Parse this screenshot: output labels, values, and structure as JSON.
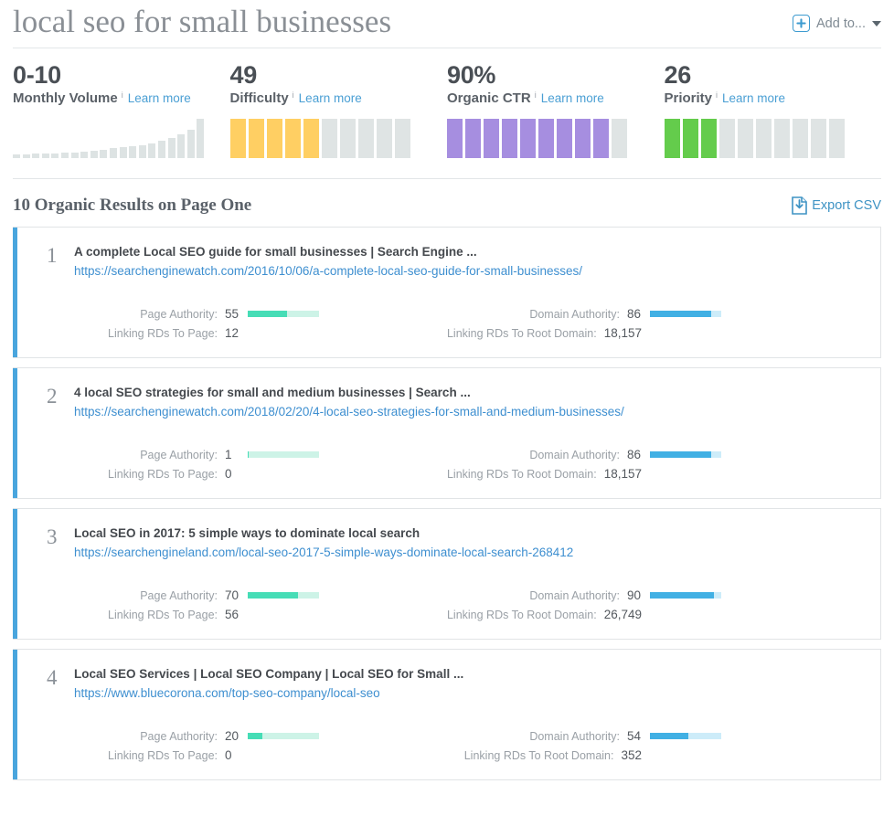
{
  "header": {
    "keyword": "local seo for small businesses",
    "add_to_label": "Add to...",
    "plus_icon": "plus-icon",
    "caret_icon": "chevron-down-icon"
  },
  "metrics": [
    {
      "value": "0-10",
      "label": "Monthly Volume",
      "info": "i",
      "learn_more": "Learn more",
      "viz": "sparkline",
      "color": "#dde3e3",
      "spark_values": [
        4,
        4,
        5,
        5,
        5,
        6,
        6,
        7,
        8,
        9,
        11,
        12,
        13,
        14,
        16,
        19,
        22,
        26,
        31,
        43
      ]
    },
    {
      "value": "49",
      "label": "Difficulty",
      "info": "i",
      "learn_more": "Learn more",
      "viz": "segments",
      "segments_total": 10,
      "segments_filled": 5,
      "color": "#ffcf63",
      "empty_color": "#dfe4e4"
    },
    {
      "value": "90%",
      "label": "Organic CTR",
      "info": "i",
      "learn_more": "Learn more",
      "viz": "segments",
      "segments_total": 10,
      "segments_filled": 9,
      "color": "#a68ee0",
      "empty_color": "#dfe4e4"
    },
    {
      "value": "26",
      "label": "Priority",
      "info": "i",
      "learn_more": "Learn more",
      "viz": "segments",
      "segments_total": 10,
      "segments_filled": 3,
      "color": "#64cc4c",
      "empty_color": "#dfe4e4"
    }
  ],
  "results_section": {
    "title": "10 Organic Results on Page One",
    "export_label": "Export CSV",
    "export_icon": "download-document-icon",
    "labels": {
      "page_authority": "Page Authority:",
      "linking_rds_page": "Linking RDs To Page:",
      "domain_authority": "Domain Authority:",
      "linking_rds_root": "Linking RDs To Root Domain:"
    },
    "accent_color": "#49a5dd",
    "pa_color": "#46ddb6",
    "da_color": "#41b0e4"
  },
  "results": [
    {
      "rank": "1",
      "title": "A complete Local SEO guide for small businesses | Search Engine ...",
      "url": "https://searchenginewatch.com/2016/10/06/a-complete-local-seo-guide-for-small-businesses/",
      "page_authority": "55",
      "page_authority_pct": 55,
      "linking_rds_page": "12",
      "domain_authority": "86",
      "domain_authority_pct": 86,
      "linking_rds_root": "18,157"
    },
    {
      "rank": "2",
      "title": "4 local SEO strategies for small and medium businesses | Search ...",
      "url": "https://searchenginewatch.com/2018/02/20/4-local-seo-strategies-for-small-and-medium-businesses/",
      "page_authority": "1",
      "page_authority_pct": 1,
      "linking_rds_page": "0",
      "domain_authority": "86",
      "domain_authority_pct": 86,
      "linking_rds_root": "18,157"
    },
    {
      "rank": "3",
      "title": "Local SEO in 2017: 5 simple ways to dominate local search",
      "url": "https://searchengineland.com/local-seo-2017-5-simple-ways-dominate-local-search-268412",
      "page_authority": "70",
      "page_authority_pct": 70,
      "linking_rds_page": "56",
      "domain_authority": "90",
      "domain_authority_pct": 90,
      "linking_rds_root": "26,749"
    },
    {
      "rank": "4",
      "title": "Local SEO Services | Local SEO Company | Local SEO for Small ...",
      "url": "https://www.bluecorona.com/top-seo-company/local-seo",
      "page_authority": "20",
      "page_authority_pct": 20,
      "linking_rds_page": "0",
      "domain_authority": "54",
      "domain_authority_pct": 54,
      "linking_rds_root": "352"
    }
  ]
}
